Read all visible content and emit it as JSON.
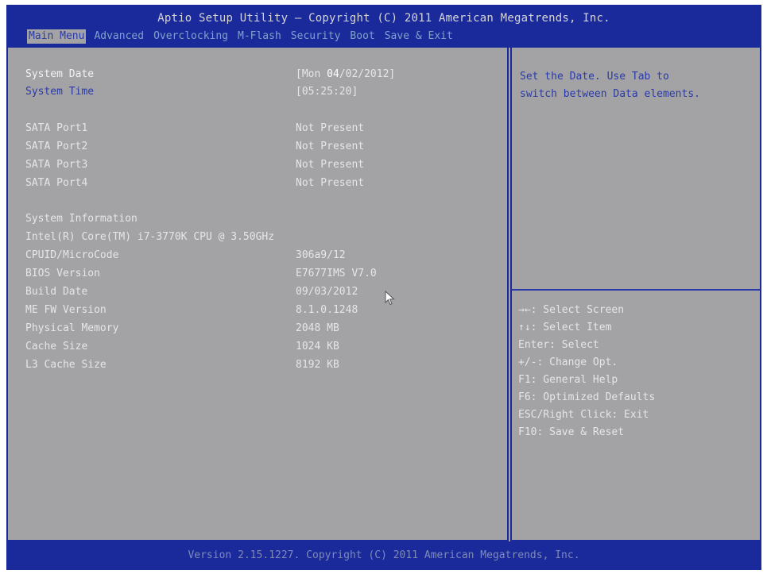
{
  "title": "Aptio Setup Utility – Copyright (C) 2011 American Megatrends, Inc.",
  "tabs": [
    {
      "label": "Main Menu"
    },
    {
      "label": "Advanced"
    },
    {
      "label": "Overclocking"
    },
    {
      "label": "M-Flash"
    },
    {
      "label": "Security"
    },
    {
      "label": "Boot"
    },
    {
      "label": "Save & Exit"
    }
  ],
  "main": {
    "system_date": {
      "label": "System Date",
      "value_prefix": "[Mon ",
      "value_highlight": "04",
      "value_suffix": "/02/2012]"
    },
    "system_time": {
      "label": "System Time",
      "value": "[05:25:20]"
    },
    "sata": [
      {
        "label": "SATA Port1",
        "value": "Not Present"
      },
      {
        "label": "SATA Port2",
        "value": "Not Present"
      },
      {
        "label": "SATA Port3",
        "value": "Not Present"
      },
      {
        "label": "SATA Port4",
        "value": "Not Present"
      }
    ],
    "system_information_label": "System Information",
    "cpu_line": "Intel(R) Core(TM) i7-3770K CPU @ 3.50GHz",
    "info": [
      {
        "label": "CPUID/MicroCode",
        "value": "306a9/12"
      },
      {
        "label": "BIOS Version",
        "value": "E7677IMS V7.0"
      },
      {
        "label": "Build Date",
        "value": "09/03/2012"
      },
      {
        "label": "ME FW Version",
        "value": "8.1.0.1248"
      },
      {
        "label": "Physical Memory",
        "value": "2048 MB"
      },
      {
        "label": "Cache Size",
        "value": "1024 KB"
      },
      {
        "label": "L3 Cache Size",
        "value": "8192 KB"
      }
    ]
  },
  "help": {
    "line1": "Set the Date. Use Tab to",
    "line2": "switch between Data elements."
  },
  "keys": [
    "→←: Select Screen",
    "↑↓: Select Item",
    "Enter: Select",
    "+/-: Change Opt.",
    "F1: General Help",
    "F6: Optimized Defaults",
    "ESC/Right Click: Exit",
    "F10: Save & Reset"
  ],
  "footer": "Version 2.15.1227. Copyright (C) 2011 American Megatrends, Inc.",
  "colors": {
    "background": "#a3a3a6",
    "frame_blue": "#1a2a9a",
    "highlight_text": "#2a3aa8",
    "text": "#e6e6e6"
  },
  "icons": {
    "cursor": "mouse-pointer-icon"
  }
}
